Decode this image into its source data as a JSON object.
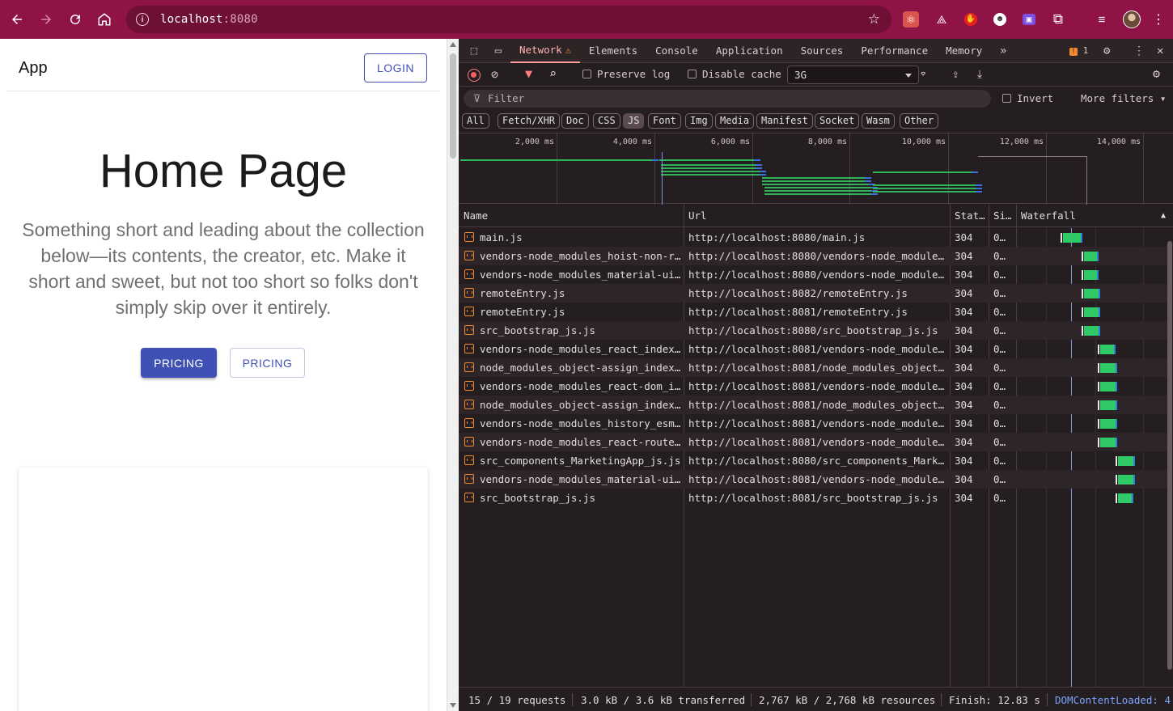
{
  "browser": {
    "url_host": "localhost",
    "url_port": ":8080"
  },
  "app": {
    "title": "App",
    "login_label": "LOGIN",
    "hero_title": "Home Page",
    "hero_subtitle": "Something short and leading about the collection below—its contents, the creator, etc. Make it short and sweet, but not too short so folks don't simply skip over it entirely.",
    "primary_button": "PRICING",
    "secondary_button": "PRICING"
  },
  "devtools": {
    "tabs": [
      "Network",
      "Elements",
      "Console",
      "Application",
      "Sources",
      "Performance",
      "Memory"
    ],
    "issues_count": "1",
    "toolbar": {
      "preserve_log": "Preserve log",
      "disable_cache": "Disable cache",
      "throttle": "3G"
    },
    "filter": {
      "placeholder": "Filter",
      "invert": "Invert",
      "more_filters": "More filters"
    },
    "types": [
      "All",
      "Fetch/XHR",
      "Doc",
      "CSS",
      "JS",
      "Font",
      "Img",
      "Media",
      "Manifest",
      "Socket",
      "Wasm",
      "Other"
    ],
    "active_type": "JS",
    "overview_ticks": [
      "2,000 ms",
      "4,000 ms",
      "6,000 ms",
      "8,000 ms",
      "10,000 ms",
      "12,000 ms",
      "14,000 ms"
    ],
    "columns": {
      "name": "Name",
      "url": "Url",
      "status": "Stat…",
      "size": "Si…",
      "waterfall": "Waterfall"
    },
    "requests": [
      {
        "name": "main.js",
        "url": "http://localhost:8080/main.js",
        "status": "304",
        "size": "0…",
        "start": 0.1,
        "end": 0.23
      },
      {
        "name": "vendors-node_modules_hoist-non-r…",
        "url": "http://localhost:8080/vendors-node_modules…",
        "status": "304",
        "size": "0…",
        "start": 0.24,
        "end": 0.34
      },
      {
        "name": "vendors-node_modules_material-ui…",
        "url": "http://localhost:8080/vendors-node_modules…",
        "status": "304",
        "size": "0…",
        "start": 0.24,
        "end": 0.34
      },
      {
        "name": "remoteEntry.js",
        "url": "http://localhost:8082/remoteEntry.js",
        "status": "304",
        "size": "0…",
        "start": 0.24,
        "end": 0.35
      },
      {
        "name": "remoteEntry.js",
        "url": "http://localhost:8081/remoteEntry.js",
        "status": "304",
        "size": "0…",
        "start": 0.24,
        "end": 0.35
      },
      {
        "name": "src_bootstrap_js.js",
        "url": "http://localhost:8080/src_bootstrap_js.js",
        "status": "304",
        "size": "0…",
        "start": 0.24,
        "end": 0.35
      },
      {
        "name": "vendors-node_modules_react_index…",
        "url": "http://localhost:8081/vendors-node_modules…",
        "status": "304",
        "size": "0…",
        "start": 0.35,
        "end": 0.45
      },
      {
        "name": "node_modules_object-assign_index…",
        "url": "http://localhost:8081/node_modules_object-…",
        "status": "304",
        "size": "0…",
        "start": 0.35,
        "end": 0.46
      },
      {
        "name": "vendors-node_modules_react-dom_i…",
        "url": "http://localhost:8081/vendors-node_modules…",
        "status": "304",
        "size": "0…",
        "start": 0.35,
        "end": 0.46
      },
      {
        "name": "node_modules_object-assign_index…",
        "url": "http://localhost:8081/node_modules_object-…",
        "status": "304",
        "size": "0…",
        "start": 0.35,
        "end": 0.46
      },
      {
        "name": "vendors-node_modules_history_esm…",
        "url": "http://localhost:8081/vendors-node_modules…",
        "status": "304",
        "size": "0…",
        "start": 0.35,
        "end": 0.46
      },
      {
        "name": "vendors-node_modules_react-route…",
        "url": "http://localhost:8081/vendors-node_modules…",
        "status": "304",
        "size": "0…",
        "start": 0.35,
        "end": 0.46
      },
      {
        "name": "src_components_MarketingApp_js.js",
        "url": "http://localhost:8080/src_components_Marke…",
        "status": "304",
        "size": "0…",
        "start": 0.47,
        "end": 0.58
      },
      {
        "name": "vendors-node_modules_material-ui…",
        "url": "http://localhost:8081/vendors-node_modules…",
        "status": "304",
        "size": "0…",
        "start": 0.47,
        "end": 0.58
      },
      {
        "name": "src_bootstrap_js.js",
        "url": "http://localhost:8081/src_bootstrap_js.js",
        "status": "304",
        "size": "0…",
        "start": 0.47,
        "end": 0.57
      }
    ],
    "status_bar": {
      "requests": "15 / 19 requests",
      "transferred": "3.0 kB / 3.6 kB transferred",
      "resources": "2,767 kB / 2,768 kB resources",
      "finish": "Finish: 12.83 s",
      "dcl": "DOMContentLoaded: 4."
    }
  }
}
